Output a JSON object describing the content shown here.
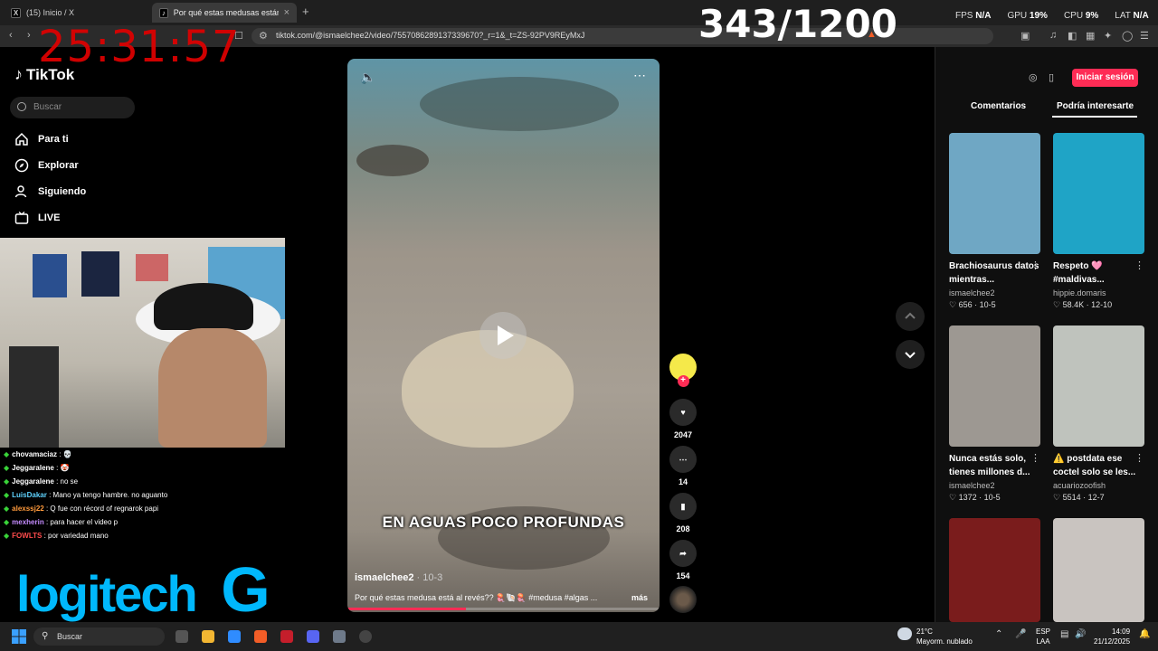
{
  "browser": {
    "tabs": [
      {
        "label": "(15) Inicio / X",
        "favicon": "X",
        "active": false
      },
      {
        "label": "Por qué estas medusas están al r",
        "favicon": "TikTok",
        "active": true
      }
    ],
    "new_tab_label": "+",
    "url": "tiktok.com/@ismaelchee2/video/7557086289137339670?_r=1&_t=ZS-92PV9REyMxJ"
  },
  "overlay": {
    "clock": "25:31:57",
    "counter": "343/1200",
    "perf": {
      "fps_label": "FPS",
      "fps_value": "N/A",
      "gpu_label": "GPU",
      "gpu_value": "19%",
      "cpu_label": "CPU",
      "cpu_value": "9%",
      "lat_label": "LAT",
      "lat_value": "N/A"
    }
  },
  "tiktok": {
    "logo": "TikTok",
    "search_placeholder": "Buscar",
    "nav": [
      {
        "label": "Para ti",
        "icon": "home-icon"
      },
      {
        "label": "Explorar",
        "icon": "compass-icon"
      },
      {
        "label": "Siguiendo",
        "icon": "following-icon"
      },
      {
        "label": "LIVE",
        "icon": "live-icon"
      }
    ],
    "login_label": "Iniciar sesión",
    "panel_tabs": [
      "Comentarios",
      "Podría interesarte"
    ]
  },
  "video": {
    "caption": "EN AGUAS POCO PROFUNDAS",
    "author": "ismaelchee2",
    "date": "· 10-3",
    "description": "Por qué estas medusa está al revés?? 🪼🐚🪼 #medusa #algas ...",
    "more": "más",
    "progress_fraction": 0.38,
    "actions": {
      "likes": "2047",
      "comments": "14",
      "saves": "208",
      "shares": "154"
    }
  },
  "recommendations": [
    {
      "title": "Brachiosaurus datos mientras...",
      "user": "ismaelchee2",
      "likes": "656",
      "date": "10-5",
      "thumb_color": "#6fa7c4"
    },
    {
      "title": "Respeto 🩷 #maldivas...",
      "user": "hippie.domaris",
      "likes": "58.4K",
      "date": "12-10",
      "thumb_color": "#1fa4c6"
    },
    {
      "title": "Nunca estás solo, tienes millones d...",
      "user": "ismaelchee2",
      "likes": "1372",
      "date": "10-5",
      "thumb_color": "#9d9892"
    },
    {
      "title": "⚠️ postdata ese coctel solo se les...",
      "user": "acuariozoofish",
      "likes": "5514",
      "date": "12-7",
      "thumb_color": "#bfc3bd"
    },
    {
      "title": "",
      "user": "",
      "likes": "",
      "date": "",
      "thumb_color": "#7a1c1c"
    },
    {
      "title": "",
      "user": "",
      "likes": "",
      "date": "",
      "thumb_color": "#c9c4c0"
    }
  ],
  "stream_chat": [
    {
      "user": "chovamaciaz",
      "msg": ": 💀",
      "color": "#ffffff"
    },
    {
      "user": "Jeggaralene",
      "msg": ": 🤡",
      "color": "#ffffff"
    },
    {
      "user": "Jeggaralene",
      "msg": ": no se",
      "color": "#ffffff"
    },
    {
      "user": "LuisDakar",
      "msg": ": Mano ya tengo hambre. no aguanto",
      "color": "#5fd3ff"
    },
    {
      "user": "alexssj22",
      "msg": ": Q fue con récord of regnarok papi",
      "color": "#ff9a3c"
    },
    {
      "user": "mexherin",
      "msg": ": para hacer el video p",
      "color": "#c58cff"
    },
    {
      "user": "FOWLTS",
      "msg": ": por variedad mano",
      "color": "#ff4c4c"
    }
  ],
  "sponsor": "logitech",
  "taskbar": {
    "search_placeholder": "Buscar",
    "weather_temp": "21°C",
    "weather_desc": "Mayorm. nublado",
    "lang_top": "ESP",
    "lang_bottom": "LAA",
    "time": "14:09",
    "date": "21/12/2025"
  }
}
